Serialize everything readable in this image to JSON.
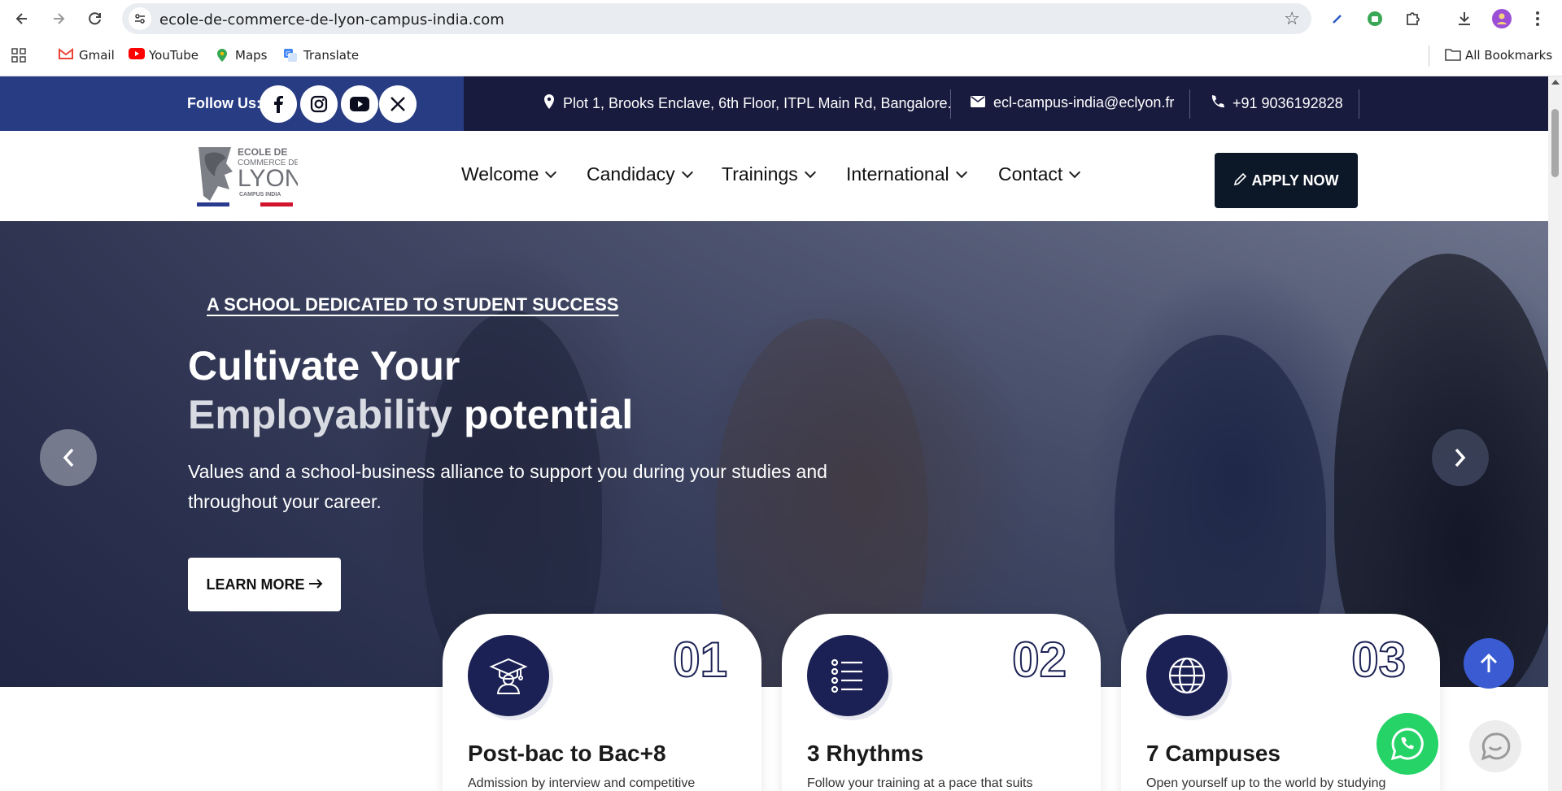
{
  "browser": {
    "url": "ecole-de-commerce-de-lyon-campus-india.com",
    "bookmarks": [
      {
        "label": "Gmail",
        "icon": "gmail-icon"
      },
      {
        "label": "YouTube",
        "icon": "youtube-icon"
      },
      {
        "label": "Maps",
        "icon": "maps-icon"
      },
      {
        "label": "Translate",
        "icon": "translate-icon"
      }
    ],
    "all_bookmarks_label": "All Bookmarks"
  },
  "topbar": {
    "follow_label": "Follow Us:",
    "socials": [
      "facebook-icon",
      "instagram-icon",
      "youtube-icon",
      "x-icon"
    ],
    "address": "Plot 1, Brooks Enclave, 6th Floor, ITPL Main Rd, Bangalore.",
    "email": "ecl-campus-india@eclyon.fr",
    "phone": "+91 9036192828"
  },
  "header": {
    "logo_text": {
      "line1": "ECOLE DE",
      "line2": "COMMERCE DE",
      "line3": "LYON",
      "line4": "CAMPUS INDIA"
    },
    "nav": [
      "Welcome",
      "Candidacy",
      "Trainings",
      "International",
      "Contact"
    ],
    "apply_label": "APPLY NOW"
  },
  "hero": {
    "eyebrow": "A SCHOOL DEDICATED TO STUDENT SUCCESS",
    "headline_line1": "Cultivate Your",
    "headline_muted": "Employability",
    "headline_rest": " potential",
    "subtext": "Values and a school-business alliance to support you during your studies and throughout your career.",
    "cta_label": "LEARN MORE"
  },
  "cards": [
    {
      "num": "01",
      "title": "Post-bac to Bac+8",
      "desc": "Admission by interview and competitive",
      "icon": "graduate-icon"
    },
    {
      "num": "02",
      "title": "3 Rhythms",
      "desc": "Follow your training at a pace that suits",
      "icon": "list-icon"
    },
    {
      "num": "03",
      "title": "7 Campuses",
      "desc": "Open yourself up to the world by studying",
      "icon": "globe-icon"
    }
  ],
  "colors": {
    "topbar_dark": "#181a3e",
    "topbar_blue": "#283c83",
    "apply_bg": "#0c1728",
    "card_icon_bg": "#1b2154",
    "scroll_top_bg": "#3a5bd2",
    "whatsapp_green": "#25d366"
  }
}
